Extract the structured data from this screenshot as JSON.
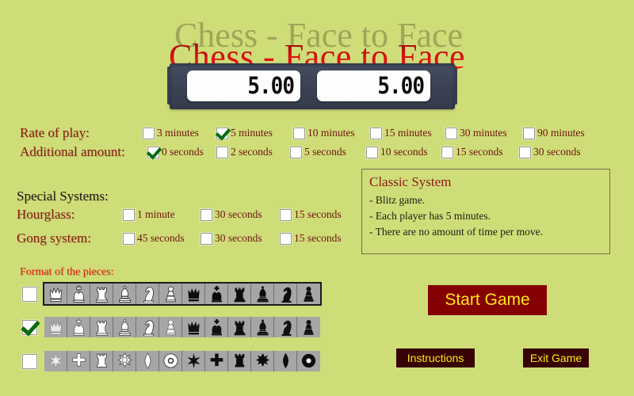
{
  "app": {
    "title": "Chess - Face to Face",
    "background_color": "#cfdd78",
    "title_color": "#e00000"
  },
  "clock": {
    "left_display": "5.00",
    "right_display": "5.00",
    "body_color": "#3c4457"
  },
  "rate_of_play": {
    "label": "Rate of play:",
    "options": [
      {
        "label": "3 minutes",
        "checked": false
      },
      {
        "label": "5 minutes",
        "checked": true
      },
      {
        "label": "10 minutes",
        "checked": false
      },
      {
        "label": "15 minutes",
        "checked": false
      },
      {
        "label": "30 minutes",
        "checked": false
      },
      {
        "label": "90 minutes",
        "checked": false
      }
    ]
  },
  "additional_amount": {
    "label": "Additional amount:",
    "options": [
      {
        "label": "0 seconds",
        "checked": true
      },
      {
        "label": "2 seconds",
        "checked": false
      },
      {
        "label": "5 seconds",
        "checked": false
      },
      {
        "label": "10 seconds",
        "checked": false
      },
      {
        "label": "15 seconds",
        "checked": false
      },
      {
        "label": "30 seconds",
        "checked": false
      }
    ]
  },
  "special_systems": {
    "label": "Special Systems:",
    "hourglass": {
      "label": "Hourglass:",
      "options": [
        {
          "label": "1 minute",
          "checked": false
        },
        {
          "label": "30 seconds",
          "checked": false
        },
        {
          "label": "15 seconds",
          "checked": false
        }
      ]
    },
    "gong": {
      "label": "Gong system:",
      "options": [
        {
          "label": "45 seconds",
          "checked": false
        },
        {
          "label": "30 seconds",
          "checked": false
        },
        {
          "label": "15 seconds",
          "checked": false
        }
      ]
    }
  },
  "info_panel": {
    "title": "Classic System",
    "lines": [
      "- Blitz game.",
      "- Each player has 5 minutes.",
      "- There are no amount of time per move."
    ]
  },
  "piece_format": {
    "label": "Format of the pieces:",
    "sets": [
      {
        "name": "standard-staunton",
        "checked": false,
        "pieces": [
          "white-queen",
          "white-king",
          "white-rook",
          "white-bishop",
          "white-knight",
          "white-pawn",
          "black-queen",
          "black-king",
          "black-rook",
          "black-bishop",
          "black-knight",
          "black-pawn"
        ]
      },
      {
        "name": "outline-staunton",
        "checked": true,
        "pieces": [
          "white-queen",
          "white-king",
          "white-rook",
          "white-bishop",
          "white-knight",
          "white-pawn",
          "black-queen",
          "black-king",
          "black-rook",
          "black-bishop",
          "black-knight",
          "black-pawn"
        ]
      },
      {
        "name": "abstract-symbols",
        "checked": false,
        "pieces": [
          "white-star",
          "white-cross",
          "white-tower",
          "white-diamond-cross",
          "white-diamond",
          "white-disc",
          "black-star",
          "black-cross",
          "black-tower",
          "black-diamond-cross",
          "black-diamond",
          "black-disc"
        ]
      }
    ]
  },
  "buttons": {
    "start": "Start Game",
    "instructions": "Instructions",
    "exit": "Exit Game",
    "start_color": "#850000",
    "small_color": "#380303",
    "text_color": "#ffe81a"
  }
}
